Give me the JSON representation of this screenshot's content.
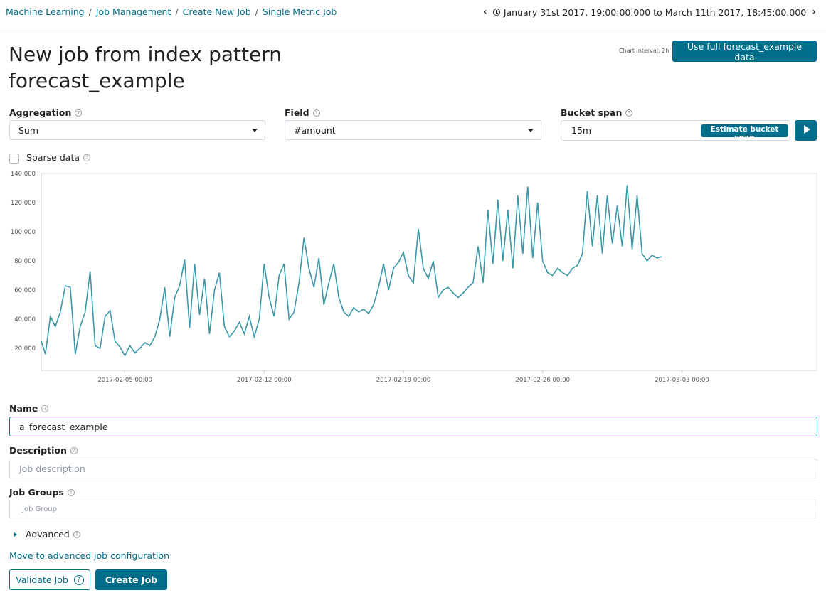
{
  "breadcrumbs": [
    "Machine Learning",
    "Job Management",
    "Create New Job",
    "Single Metric Job"
  ],
  "time_range": "January 31st 2017, 19:00:00.000 to March 11th 2017, 18:45:00.000",
  "page_title": "New job from index pattern forecast_example",
  "chart_interval": "Chart interval: 2h",
  "use_full_button": "Use full forecast_example data",
  "aggregation": {
    "label": "Aggregation",
    "value": "Sum"
  },
  "field": {
    "label": "Field",
    "value": "#amount"
  },
  "bucket_span": {
    "label": "Bucket span",
    "value": "15m",
    "estimate_label": "Estimate bucket span"
  },
  "sparse_data": {
    "label": "Sparse data",
    "checked": false
  },
  "chart_data": {
    "type": "line",
    "color": "#3a98a9",
    "x_ticks": [
      "2017-02-05 00:00",
      "2017-02-12 00:00",
      "2017-02-19 00:00",
      "2017-02-26 00:00",
      "2017-03-05 00:00"
    ],
    "y_ticks": [
      "20,000",
      "40,000",
      "60,000",
      "80,000",
      "100,000",
      "120,000",
      "140,000"
    ],
    "ylim": [
      5000,
      140000
    ],
    "x_start": "2017-01-31 19:00",
    "x_end": "2017-03-11 18:45",
    "points": [
      [
        "2017-01-31 19:00",
        25000
      ],
      [
        "2017-02-01 00:00",
        16000
      ],
      [
        "2017-02-01 06:00",
        42000
      ],
      [
        "2017-02-01 12:00",
        35000
      ],
      [
        "2017-02-01 18:00",
        45000
      ],
      [
        "2017-02-02 00:00",
        63000
      ],
      [
        "2017-02-02 06:00",
        62000
      ],
      [
        "2017-02-02 12:00",
        16000
      ],
      [
        "2017-02-02 18:00",
        35000
      ],
      [
        "2017-02-03 00:00",
        45000
      ],
      [
        "2017-02-03 06:00",
        73000
      ],
      [
        "2017-02-03 12:00",
        22000
      ],
      [
        "2017-02-03 18:00",
        20000
      ],
      [
        "2017-02-04 00:00",
        42000
      ],
      [
        "2017-02-04 06:00",
        46000
      ],
      [
        "2017-02-04 12:00",
        25000
      ],
      [
        "2017-02-04 18:00",
        21000
      ],
      [
        "2017-02-05 00:00",
        15000
      ],
      [
        "2017-02-05 06:00",
        22000
      ],
      [
        "2017-02-05 12:00",
        17000
      ],
      [
        "2017-02-05 18:00",
        20000
      ],
      [
        "2017-02-06 00:00",
        24000
      ],
      [
        "2017-02-06 06:00",
        22000
      ],
      [
        "2017-02-06 12:00",
        28000
      ],
      [
        "2017-02-06 18:00",
        40000
      ],
      [
        "2017-02-07 00:00",
        62000
      ],
      [
        "2017-02-07 06:00",
        28000
      ],
      [
        "2017-02-07 12:00",
        55000
      ],
      [
        "2017-02-07 18:00",
        63000
      ],
      [
        "2017-02-08 00:00",
        81000
      ],
      [
        "2017-02-08 06:00",
        34000
      ],
      [
        "2017-02-08 12:00",
        78000
      ],
      [
        "2017-02-08 18:00",
        43000
      ],
      [
        "2017-02-09 00:00",
        68000
      ],
      [
        "2017-02-09 06:00",
        30000
      ],
      [
        "2017-02-09 12:00",
        60000
      ],
      [
        "2017-02-09 18:00",
        72000
      ],
      [
        "2017-02-10 00:00",
        35000
      ],
      [
        "2017-02-10 06:00",
        28000
      ],
      [
        "2017-02-10 12:00",
        32000
      ],
      [
        "2017-02-10 18:00",
        38000
      ],
      [
        "2017-02-11 00:00",
        30000
      ],
      [
        "2017-02-11 06:00",
        42000
      ],
      [
        "2017-02-11 12:00",
        28000
      ],
      [
        "2017-02-11 18:00",
        40000
      ],
      [
        "2017-02-12 00:00",
        78000
      ],
      [
        "2017-02-12 06:00",
        55000
      ],
      [
        "2017-02-12 12:00",
        42000
      ],
      [
        "2017-02-12 18:00",
        70000
      ],
      [
        "2017-02-13 00:00",
        78000
      ],
      [
        "2017-02-13 06:00",
        40000
      ],
      [
        "2017-02-13 12:00",
        45000
      ],
      [
        "2017-02-13 18:00",
        65000
      ],
      [
        "2017-02-14 00:00",
        96000
      ],
      [
        "2017-02-14 06:00",
        75000
      ],
      [
        "2017-02-14 12:00",
        62000
      ],
      [
        "2017-02-14 18:00",
        82000
      ],
      [
        "2017-02-15 00:00",
        50000
      ],
      [
        "2017-02-15 06:00",
        65000
      ],
      [
        "2017-02-15 12:00",
        78000
      ],
      [
        "2017-02-15 18:00",
        55000
      ],
      [
        "2017-02-16 00:00",
        45000
      ],
      [
        "2017-02-16 06:00",
        42000
      ],
      [
        "2017-02-16 12:00",
        48000
      ],
      [
        "2017-02-16 18:00",
        45000
      ],
      [
        "2017-02-17 00:00",
        47000
      ],
      [
        "2017-02-17 06:00",
        44000
      ],
      [
        "2017-02-17 12:00",
        50000
      ],
      [
        "2017-02-17 18:00",
        62000
      ],
      [
        "2017-02-18 00:00",
        78000
      ],
      [
        "2017-02-18 06:00",
        60000
      ],
      [
        "2017-02-18 12:00",
        75000
      ],
      [
        "2017-02-18 18:00",
        79000
      ],
      [
        "2017-02-19 00:00",
        86000
      ],
      [
        "2017-02-19 06:00",
        70000
      ],
      [
        "2017-02-19 12:00",
        65000
      ],
      [
        "2017-02-19 18:00",
        102000
      ],
      [
        "2017-02-20 00:00",
        75000
      ],
      [
        "2017-02-20 06:00",
        68000
      ],
      [
        "2017-02-20 12:00",
        80000
      ],
      [
        "2017-02-20 18:00",
        55000
      ],
      [
        "2017-02-21 00:00",
        60000
      ],
      [
        "2017-02-21 06:00",
        62000
      ],
      [
        "2017-02-21 12:00",
        58000
      ],
      [
        "2017-02-21 18:00",
        55000
      ],
      [
        "2017-02-22 00:00",
        58000
      ],
      [
        "2017-02-22 06:00",
        62000
      ],
      [
        "2017-02-22 12:00",
        65000
      ],
      [
        "2017-02-22 18:00",
        90000
      ],
      [
        "2017-02-23 00:00",
        65000
      ],
      [
        "2017-02-23 06:00",
        115000
      ],
      [
        "2017-02-23 12:00",
        78000
      ],
      [
        "2017-02-23 18:00",
        122000
      ],
      [
        "2017-02-24 00:00",
        80000
      ],
      [
        "2017-02-24 06:00",
        115000
      ],
      [
        "2017-02-24 12:00",
        75000
      ],
      [
        "2017-02-24 18:00",
        125000
      ],
      [
        "2017-02-25 00:00",
        85000
      ],
      [
        "2017-02-25 06:00",
        131000
      ],
      [
        "2017-02-25 12:00",
        82000
      ],
      [
        "2017-02-25 18:00",
        120000
      ],
      [
        "2017-02-26 00:00",
        80000
      ],
      [
        "2017-02-26 06:00",
        72000
      ],
      [
        "2017-02-26 12:00",
        70000
      ],
      [
        "2017-02-26 18:00",
        75000
      ],
      [
        "2017-02-27 00:00",
        72000
      ],
      [
        "2017-02-27 06:00",
        70000
      ],
      [
        "2017-02-27 12:00",
        75000
      ],
      [
        "2017-02-27 18:00",
        77000
      ],
      [
        "2017-02-28 00:00",
        85000
      ],
      [
        "2017-02-28 06:00",
        128000
      ],
      [
        "2017-02-28 12:00",
        90000
      ],
      [
        "2017-02-28 18:00",
        125000
      ],
      [
        "2017-03-01 00:00",
        85000
      ],
      [
        "2017-03-01 06:00",
        125000
      ],
      [
        "2017-03-01 12:00",
        92000
      ],
      [
        "2017-03-01 18:00",
        118000
      ],
      [
        "2017-03-02 00:00",
        90000
      ],
      [
        "2017-03-02 06:00",
        132000
      ],
      [
        "2017-03-02 12:00",
        88000
      ],
      [
        "2017-03-02 18:00",
        125000
      ],
      [
        "2017-03-03 00:00",
        85000
      ],
      [
        "2017-03-03 06:00",
        80000
      ],
      [
        "2017-03-03 12:00",
        84000
      ],
      [
        "2017-03-03 18:00",
        82000
      ],
      [
        "2017-03-04 00:00",
        83000
      ]
    ]
  },
  "name": {
    "label": "Name",
    "value": "a_forecast_example"
  },
  "description": {
    "label": "Description",
    "placeholder": "Job description"
  },
  "job_groups": {
    "label": "Job Groups",
    "placeholder": "Job Group"
  },
  "advanced": "Advanced",
  "move_link": "Move to advanced job configuration",
  "validate_button": "Validate Job",
  "create_button": "Create Job"
}
